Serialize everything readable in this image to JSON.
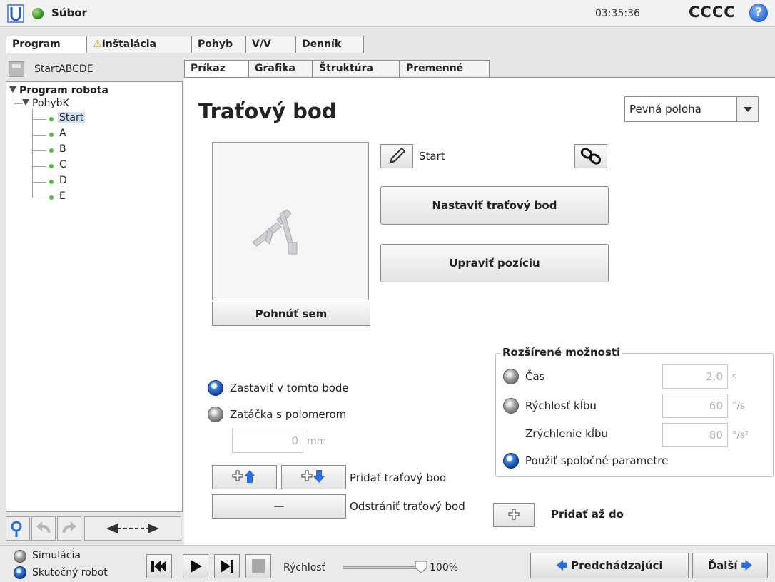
{
  "topbar": {
    "file_label": "Súbor",
    "clock": "03:35:36",
    "robot_name": "CCCC",
    "help_glyph": "?"
  },
  "main_tabs": [
    "Program",
    "Inštalácia",
    "Pohyb",
    "V/V",
    "Denník"
  ],
  "program": {
    "name": "StartABCDE",
    "tree": {
      "root": "Program robota",
      "move": "PohybK",
      "waypoints": [
        "Start",
        "A",
        "B",
        "C",
        "D",
        "E"
      ]
    }
  },
  "sub_tabs": [
    "Príkaz",
    "Grafika",
    "Štruktúra",
    "Premenné"
  ],
  "waypoint": {
    "title": "Traťový bod",
    "type_value": "Pevná poloha",
    "name": "Start",
    "set_button": "Nastaviť traťový bod",
    "edit_button": "Upraviť pozíciu",
    "move_here": "Pohnúť sem"
  },
  "blend": {
    "stop_label": "Zastaviť v tomto bode",
    "radius_label": "Zatáčka s polomerom",
    "radius_value": "0",
    "radius_unit": "mm",
    "stop_selected": true
  },
  "waypoint_actions": {
    "add_label": "Pridať traťový bod",
    "remove_label": "Odstrániť traťový bod",
    "remove_glyph": "—"
  },
  "advanced": {
    "title": "Rozšírené možnosti",
    "time_label": "Čas",
    "time_value": "2,0",
    "time_unit": "s",
    "joint_speed_label": "Rýchlosť kĺbu",
    "joint_speed_value": "60",
    "joint_speed_unit": "°/s",
    "joint_accel_label": "Zrýchlenie kĺbu",
    "joint_accel_value": "80",
    "joint_accel_unit": "°/s²",
    "shared_label": "Použiť spoločné parametre",
    "shared_selected": true
  },
  "add_until": "Pridať až do",
  "bottom": {
    "simulation": "Simulácia",
    "real_robot": "Skutočný robot",
    "speed_label": "Rýchlosť",
    "speed_value": "100%",
    "speed_fraction": 1.0,
    "prev": "Predchádzajúci",
    "next": "Ďalší"
  },
  "colors": {
    "accent_blue": "#2d6fe0",
    "tree_green": "#3d8b2a",
    "selection": "#cfe0f5",
    "warning": "#d9a400"
  }
}
